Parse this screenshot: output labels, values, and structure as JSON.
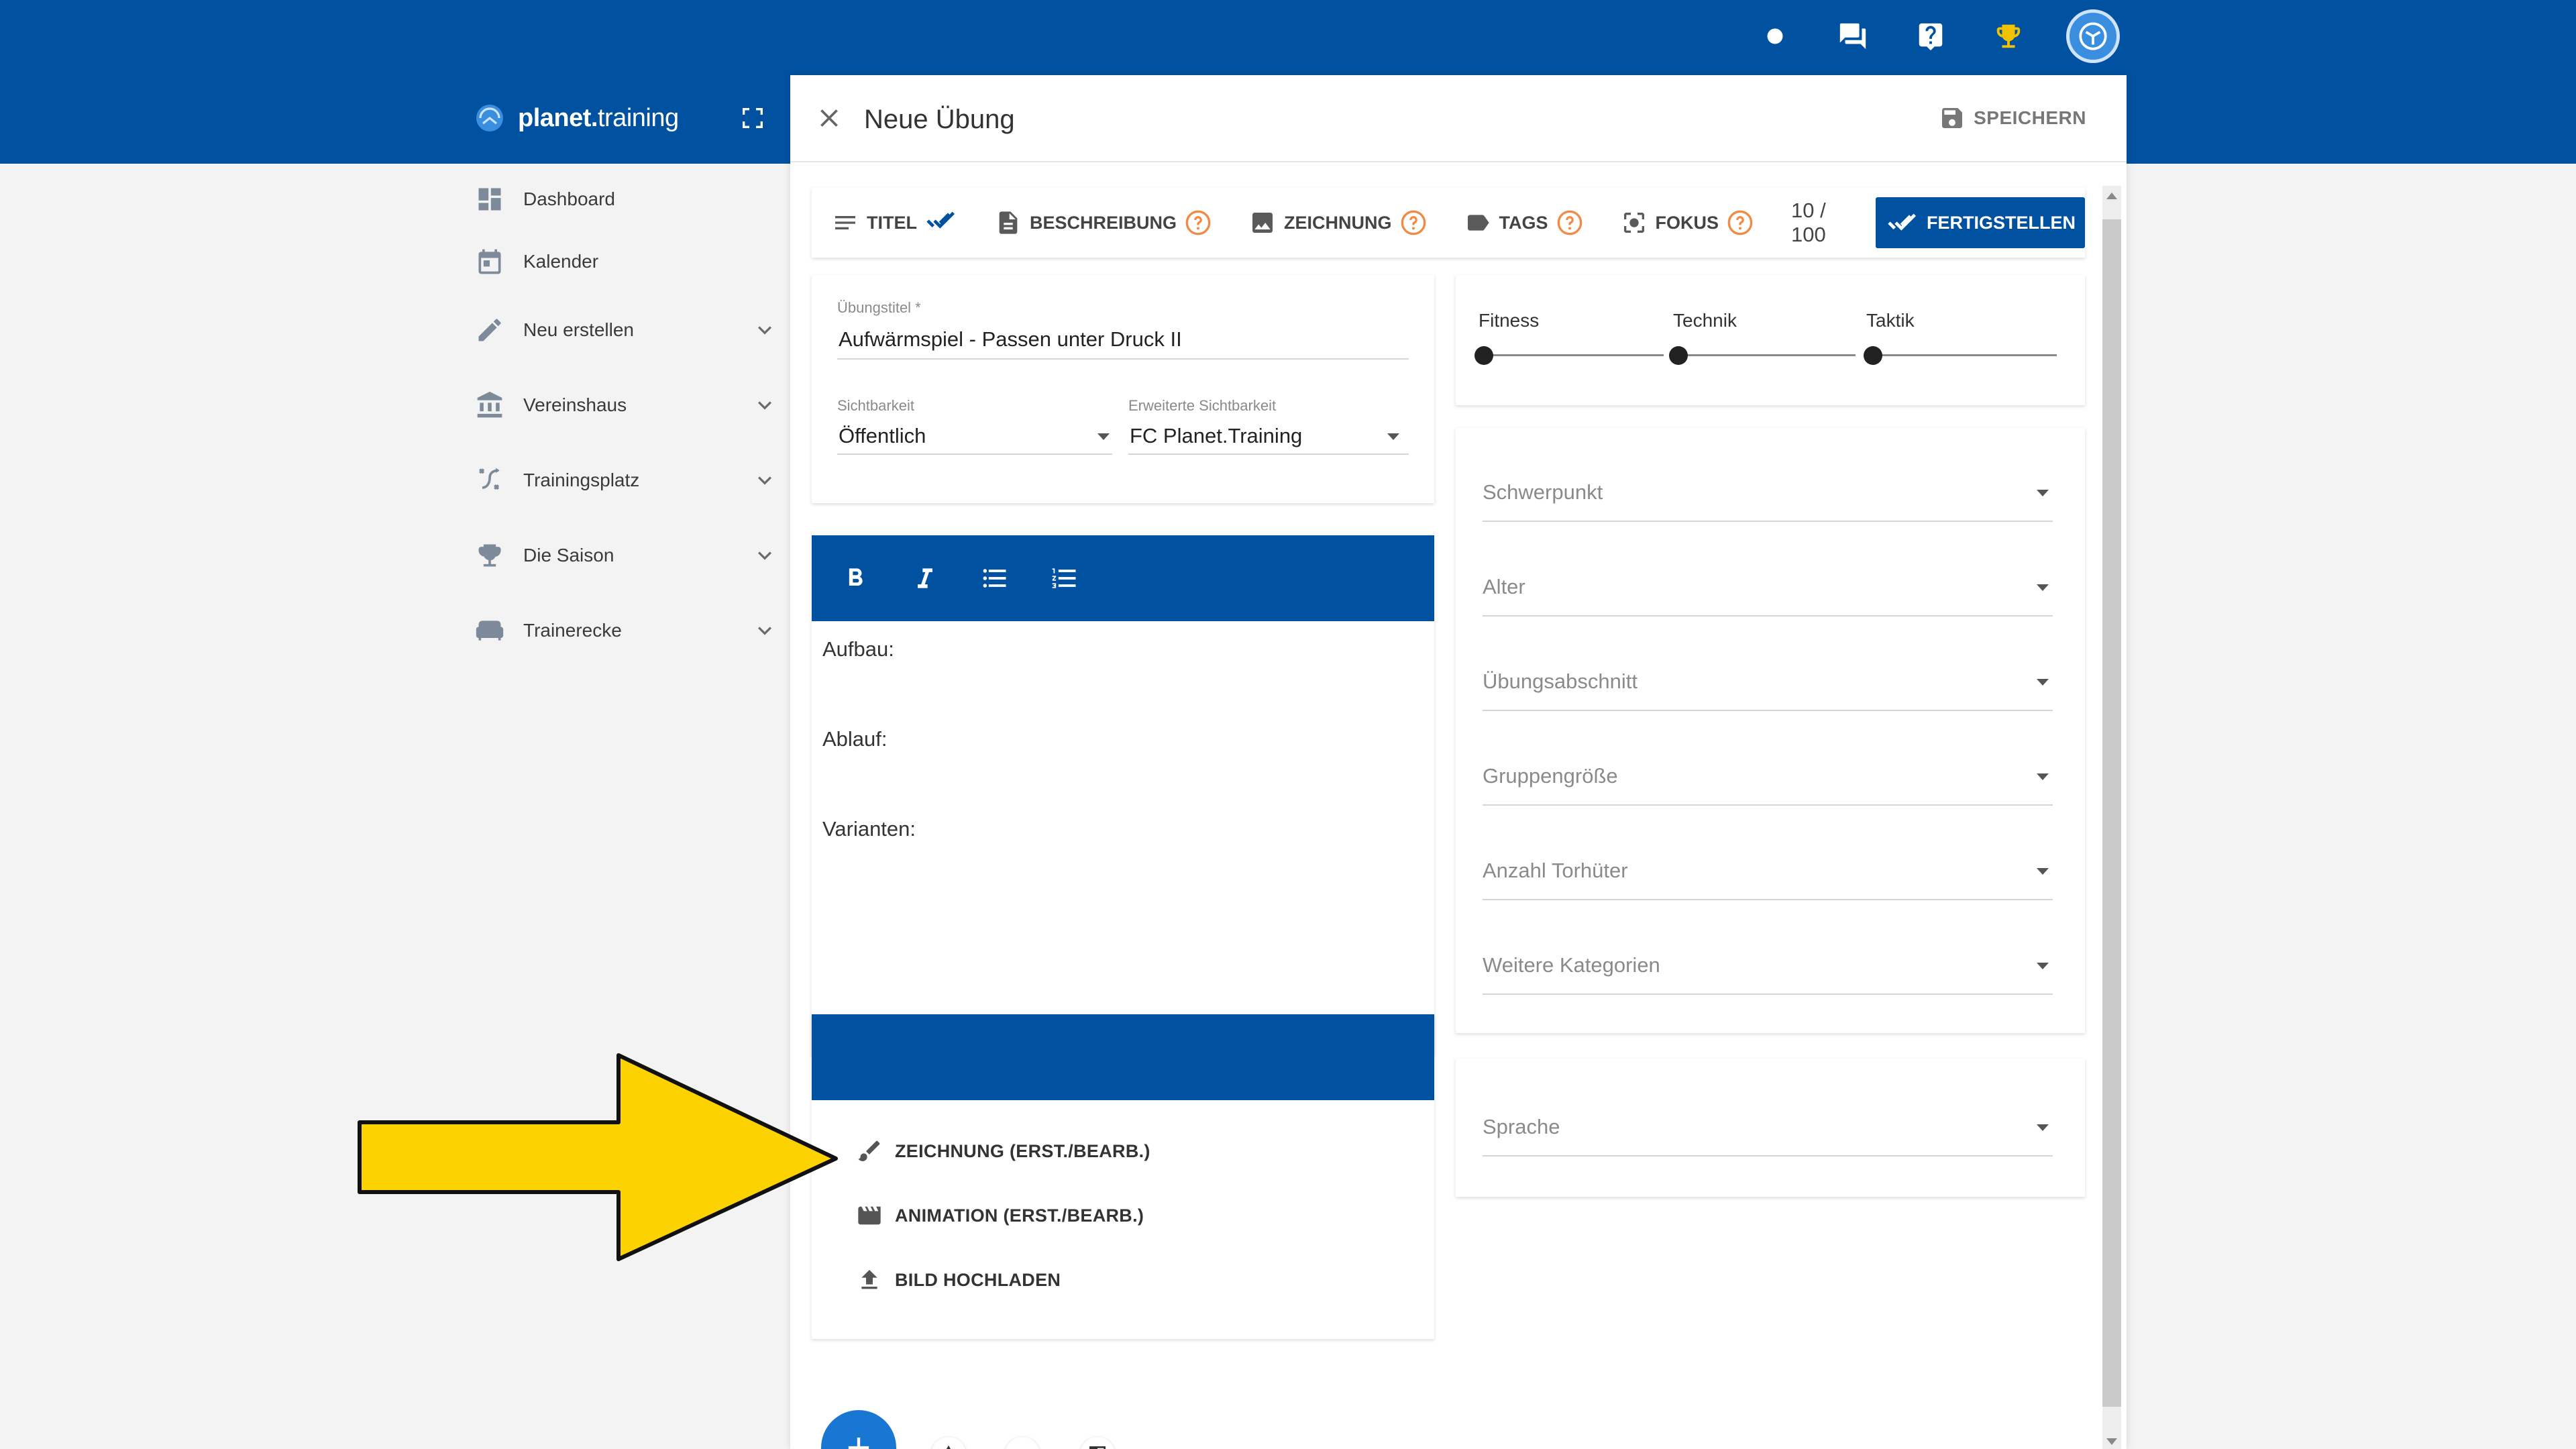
{
  "app": {
    "brand_bold": "planet.",
    "brand_rest": "training"
  },
  "colors": {
    "primary": "#0051a0",
    "background": "#f3f3f3",
    "help": "#f08a45",
    "arrow": "#fcd200"
  },
  "topbar": {
    "icons": [
      "status-dot-icon",
      "chat-icon",
      "help-icon",
      "trophy-icon",
      "avatar-icon"
    ]
  },
  "sidebar": {
    "items": [
      {
        "label": "Dashboard",
        "icon": "dashboard-icon",
        "expandable": false
      },
      {
        "label": "Kalender",
        "icon": "calendar-icon",
        "expandable": false
      },
      {
        "label": "Neu erstellen",
        "icon": "pencil-icon",
        "expandable": true
      },
      {
        "label": "Vereinshaus",
        "icon": "building-icon",
        "expandable": true
      },
      {
        "label": "Trainingsplatz",
        "icon": "tactics-icon",
        "expandable": true
      },
      {
        "label": "Die Saison",
        "icon": "trophy-icon",
        "expandable": true
      },
      {
        "label": "Trainerecke",
        "icon": "sofa-icon",
        "expandable": true
      }
    ]
  },
  "modal": {
    "title": "Neue Übung",
    "save_label": "SPEICHERN",
    "tabs": {
      "titel": "TITEL",
      "beschreibung": "BESCHREIBUNG",
      "zeichnung": "ZEICHNUNG",
      "tags": "TAGS",
      "fokus": "FOKUS",
      "counter": "10 / 100",
      "finish": "FERTIGSTELLEN"
    },
    "form": {
      "title_label": "Übungstitel *",
      "title_value": "Aufwärmspiel - Passen unter Druck II",
      "visibility_label": "Sichtbarkeit",
      "visibility_value": "Öffentlich",
      "ext_visibility_label": "Erweiterte Sichtbarkeit",
      "ext_visibility_value": "FC Planet.Training"
    },
    "editor": {
      "lines": [
        "Aufbau:",
        "Ablauf:",
        "Varianten:"
      ]
    },
    "media": {
      "drawing": "ZEICHNUNG (ERST./BEARB.)",
      "animation": "ANIMATION (ERST./BEARB.)",
      "upload": "BILD HOCHLADEN"
    },
    "sliders": [
      {
        "label": "Fitness",
        "value": 0
      },
      {
        "label": "Technik",
        "value": 0
      },
      {
        "label": "Taktik",
        "value": 0
      }
    ],
    "selects": {
      "schwerpunkt": "Schwerpunkt",
      "alter": "Alter",
      "abschnitt": "Übungsabschnitt",
      "gruppe": "Gruppengröße",
      "torhueter": "Anzahl Torhüter",
      "weitere": "Weitere Kategorien",
      "sprache": "Sprache"
    }
  }
}
